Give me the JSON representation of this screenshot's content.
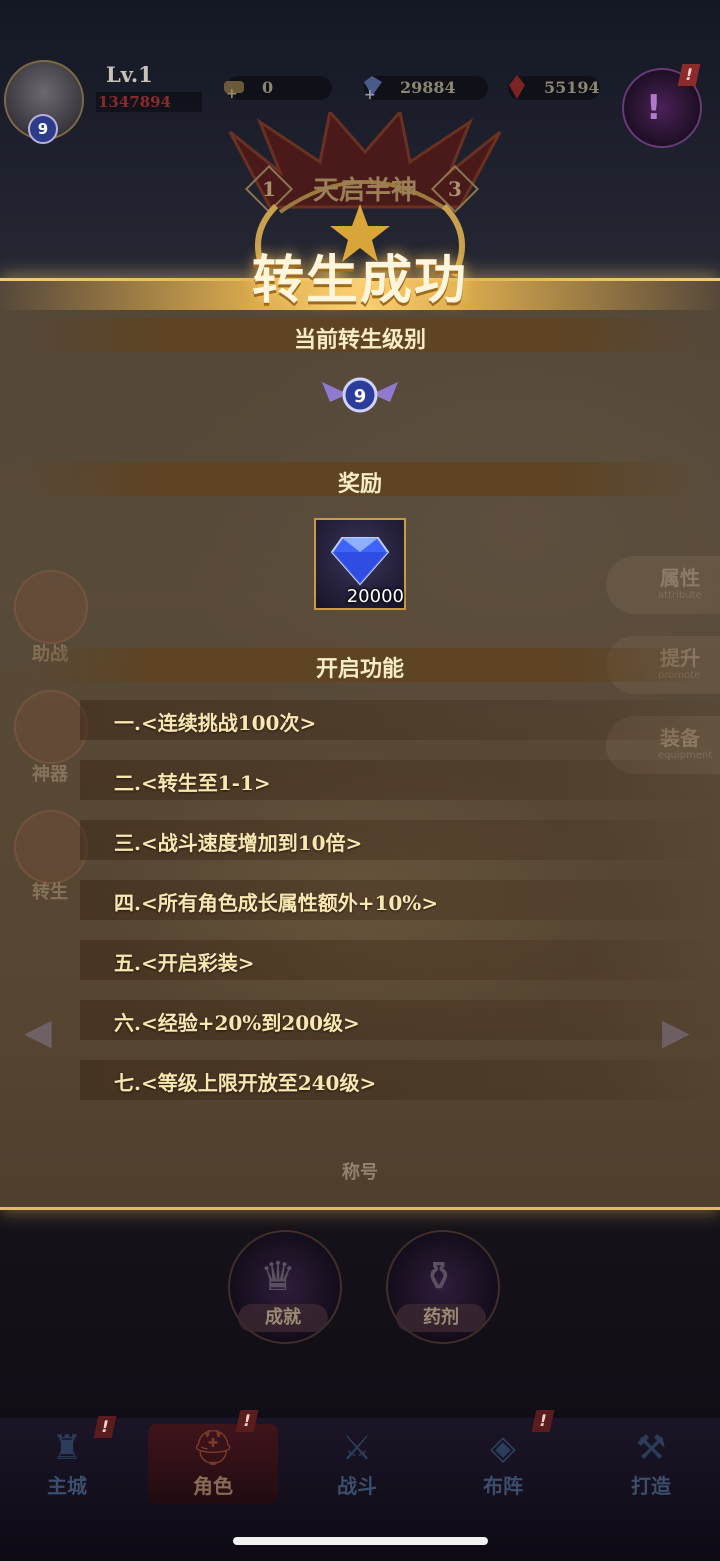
{
  "hud": {
    "level": "Lv.1",
    "power": "1347894",
    "rebirth_badge": "9",
    "resources": [
      {
        "icon": "scroll-icon",
        "value": "0"
      },
      {
        "icon": "crystal-icon",
        "value": "29884"
      },
      {
        "icon": "ruby-icon",
        "value": "55194"
      }
    ],
    "menu_glyph": "!"
  },
  "crest": {
    "class_name": "天启半神",
    "left_rank": "1",
    "right_rank": "3"
  },
  "panel": {
    "title": "转生成功",
    "current_level_header": "当前转生级别",
    "current_level_value": "9",
    "reward_header": "奖励",
    "reward": {
      "icon": "diamond-icon",
      "quantity": "20000"
    },
    "features_header": "开启功能",
    "features": [
      "一.<连续挑战100次>",
      "二.<转生至1-1>",
      "三.<战斗速度增加到10倍>",
      "四.<所有角色成长属性额外+10%>",
      "五.<开启彩装>",
      "六.<经验+20%到200级>",
      "七.<等级上限开放至240级>"
    ]
  },
  "side_left": [
    {
      "label": "助战"
    },
    {
      "label": "神器"
    },
    {
      "label": "转生"
    }
  ],
  "side_right": [
    {
      "label": "属性",
      "sub": "attribute"
    },
    {
      "label": "提升",
      "sub": "promote"
    },
    {
      "label": "装备",
      "sub": "equipment"
    }
  ],
  "title_button": "称号",
  "lower_buttons": [
    {
      "label": "成就",
      "icon": "trophy-icon"
    },
    {
      "label": "药剂",
      "icon": "potion-icon"
    }
  ],
  "nav": [
    {
      "label": "主城",
      "icon": "city-icon"
    },
    {
      "label": "角色",
      "icon": "helmet-icon"
    },
    {
      "label": "战斗",
      "icon": "crossed-swords-icon"
    },
    {
      "label": "布阵",
      "icon": "formation-icon"
    },
    {
      "label": "打造",
      "icon": "anvil-icon"
    }
  ],
  "alert_mark": "!"
}
